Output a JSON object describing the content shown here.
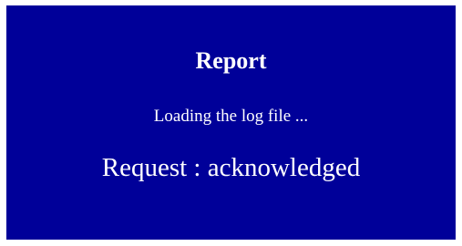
{
  "report": {
    "title": "Report",
    "status_text": "Loading the log file ...",
    "request_text": "Request : acknowledged"
  },
  "colors": {
    "background": "#000099",
    "text": "#ffffff",
    "page": "#ffffff"
  }
}
